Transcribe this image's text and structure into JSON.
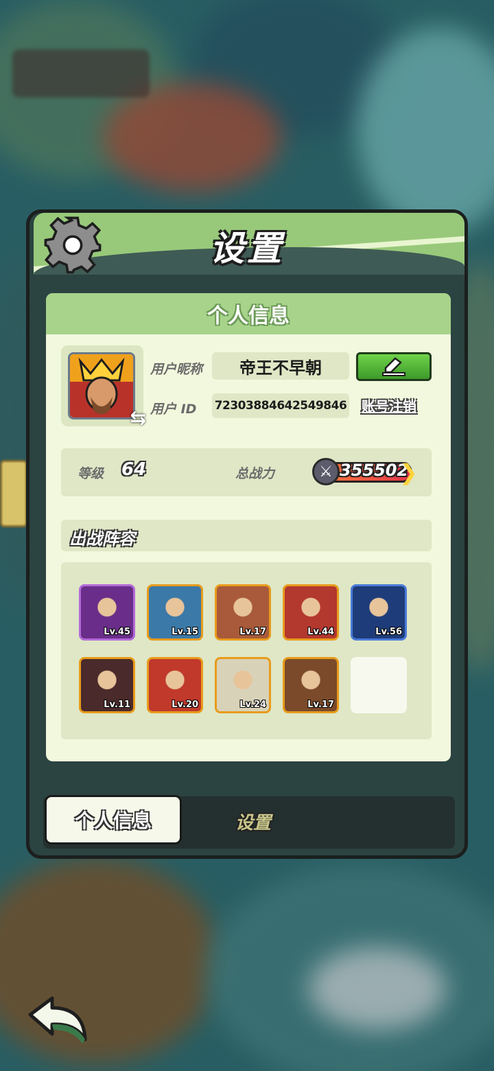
{
  "dialog": {
    "title": "设置",
    "panel_title": "个人信息"
  },
  "profile": {
    "nickname_label": "用户昵称",
    "nickname": "帝王不早朝",
    "id_label": "用户 ID",
    "user_id": "7230388464254984",
    "user_id_suffix": "6",
    "cancel_account_label": "账号注销"
  },
  "stats": {
    "level_label": "等级",
    "level": "64",
    "power_label": "总战力",
    "power": "355502"
  },
  "lineup": {
    "title": "出战阵容",
    "heroes": [
      {
        "lv": "Lv.45",
        "color": "#6a2e8a",
        "border": "#b36ad8"
      },
      {
        "lv": "Lv.15",
        "color": "#3b79a8",
        "border": "#e89b1c"
      },
      {
        "lv": "Lv.17",
        "color": "#a85a3a",
        "border": "#e89b1c"
      },
      {
        "lv": "Lv.44",
        "color": "#b3382e",
        "border": "#e89b1c"
      },
      {
        "lv": "Lv.56",
        "color": "#1f3c7a",
        "border": "#4a7bd8"
      },
      {
        "lv": "Lv.11",
        "color": "#4a2a2a",
        "border": "#e89b1c"
      },
      {
        "lv": "Lv.20",
        "color": "#c0392b",
        "border": "#e89b1c"
      },
      {
        "lv": "Lv.24",
        "color": "#d8d2b8",
        "border": "#e89b1c"
      },
      {
        "lv": "Lv.17",
        "color": "#7a4a2a",
        "border": "#e89b1c"
      }
    ]
  },
  "tabs": {
    "active": "个人信息",
    "other": "设置"
  },
  "colors": {
    "header_green": "#98c97a",
    "panel_bg": "#f2f8dd",
    "edit_green": "#5bbf3a"
  }
}
